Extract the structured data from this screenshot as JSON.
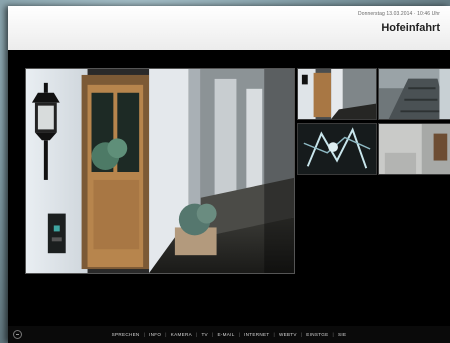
{
  "header": {
    "date": "Donnerstag 13.03.2014 · 10:46 Uhr",
    "title": "Hofeinfahrt"
  },
  "cameras": {
    "main": {
      "icon": "camera-feed-entrance"
    },
    "thumbnails": [
      {
        "icon": "camera-feed-entrance"
      },
      {
        "icon": "camera-feed-stairs"
      },
      {
        "icon": "camera-feed-garden"
      },
      {
        "icon": "camera-feed-hallway"
      }
    ]
  },
  "nav": {
    "items": [
      "SPRECHEN",
      "INFO",
      "KAMERA",
      "TV",
      "E-MAIL",
      "INTERNET",
      "WEBTV",
      "EINSTGE",
      "SIE"
    ],
    "separator": "|"
  },
  "colors": {
    "header_bg": "#ffffff",
    "screen_bg": "#000000",
    "nav_text": "#d8d8d8"
  }
}
